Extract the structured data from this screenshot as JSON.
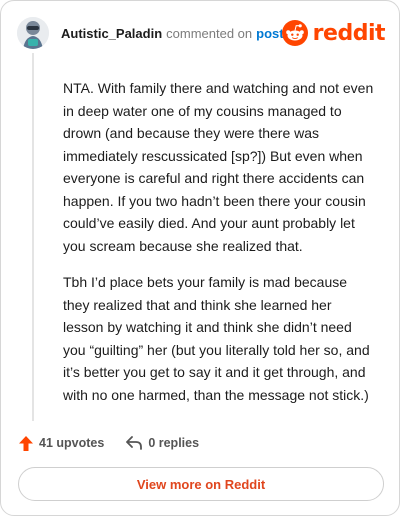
{
  "header": {
    "author": "Autistic_Paladin",
    "action": "commented on",
    "target": "post"
  },
  "brand": {
    "wordmark": "reddit",
    "color": "#ff4500"
  },
  "comment": {
    "paragraphs": [
      "NTA. With family there and watching and not even in deep water one of my cousins managed to drown (and because they were there was immediately rescussicated [sp?]) But even when everyone is careful and right there accidents can happen. If you two hadn’t been there your cousin could’ve easily died. And your aunt probably let you scream because she realized that.",
      "Tbh I’d place bets your family is mad because they realized that and think she learned her lesson by watching it and think she didn’t need you “guilting” her (but you literally told her so, and it’s better you get to say it and it get through, and with no one harmed, than the message not stick.)"
    ]
  },
  "footer": {
    "upvotes": "41 upvotes",
    "replies": "0 replies"
  },
  "cta": {
    "label": "View more on Reddit"
  },
  "colors": {
    "accent": "#ff4500",
    "link": "#0079d3",
    "muted": "#7c7c7c"
  },
  "icons": [
    "avatar-icon",
    "reddit-logo-icon",
    "upvote-arrow-icon",
    "reply-arrow-icon"
  ]
}
